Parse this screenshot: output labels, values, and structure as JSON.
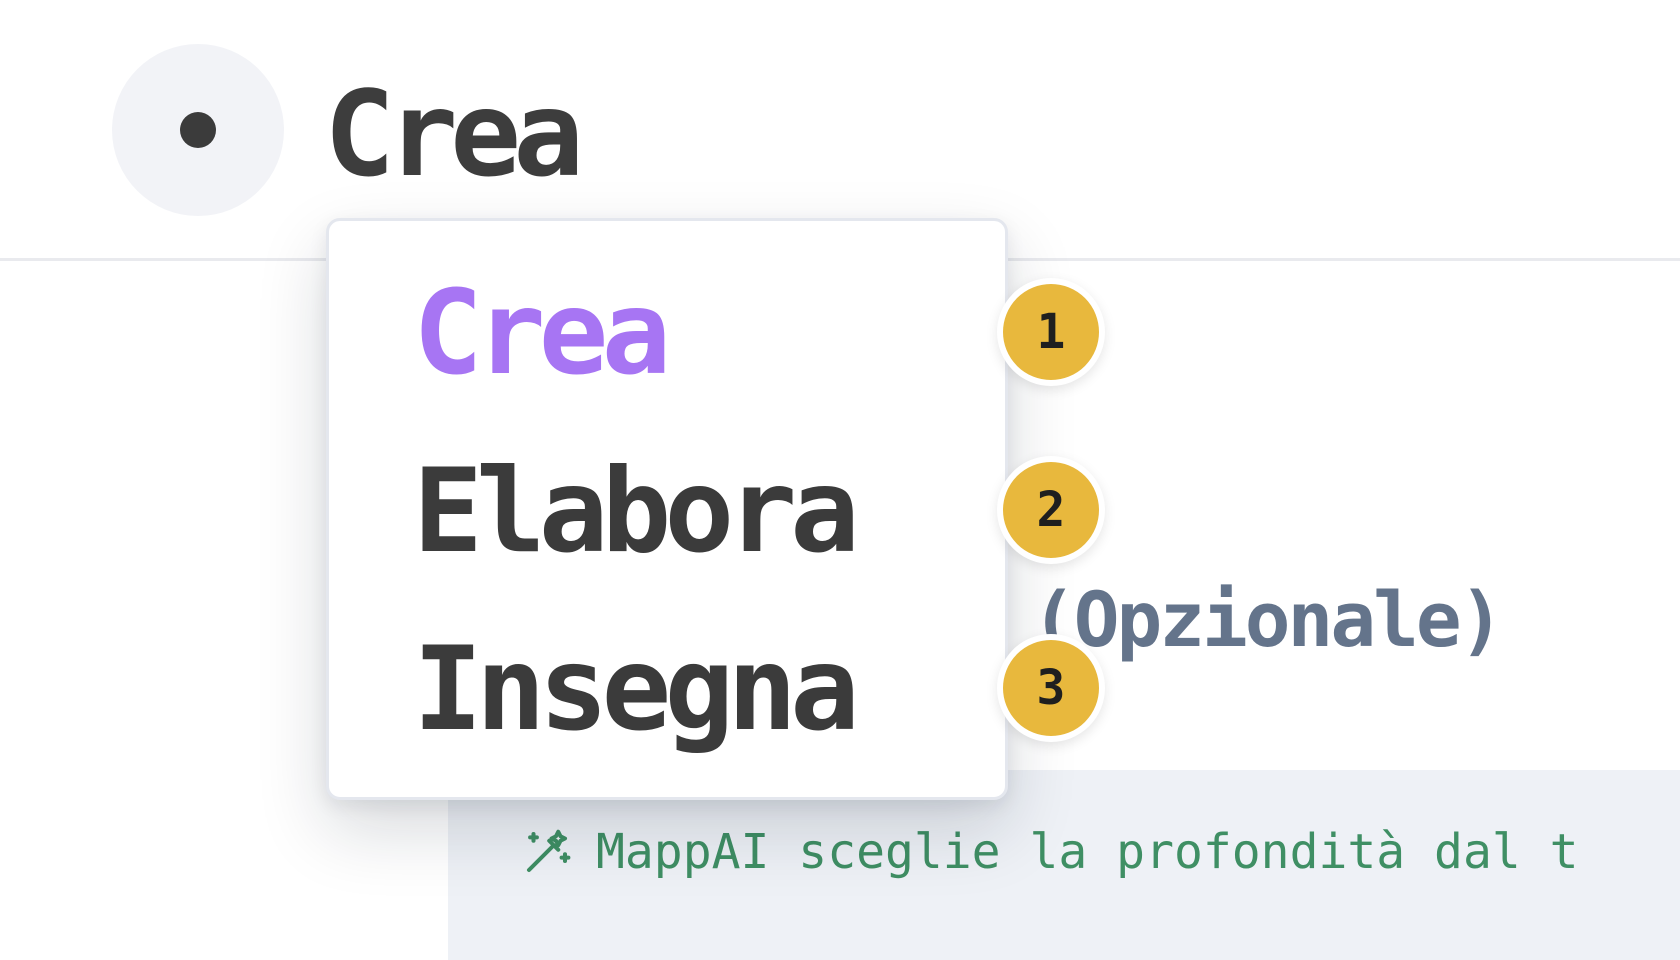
{
  "header": {
    "title": "Crea"
  },
  "background": {
    "optional_label": "ico (Opzionale)",
    "info_text": "MappAI sceglie la profondità dal t"
  },
  "dropdown": {
    "items": [
      {
        "label": "Crea",
        "active": true
      },
      {
        "label": "Elabora",
        "active": false
      },
      {
        "label": "Insegna",
        "active": false
      }
    ]
  },
  "badges": [
    "1",
    "2",
    "3"
  ],
  "colors": {
    "active_item": "#a775f3",
    "text": "#3b3b3b",
    "badge": "#e8b83d",
    "info_text": "#3f8f64",
    "info_bg": "#eef1f6"
  },
  "icons": {
    "avatar": "dot-icon",
    "info": "magic-wand-icon"
  }
}
